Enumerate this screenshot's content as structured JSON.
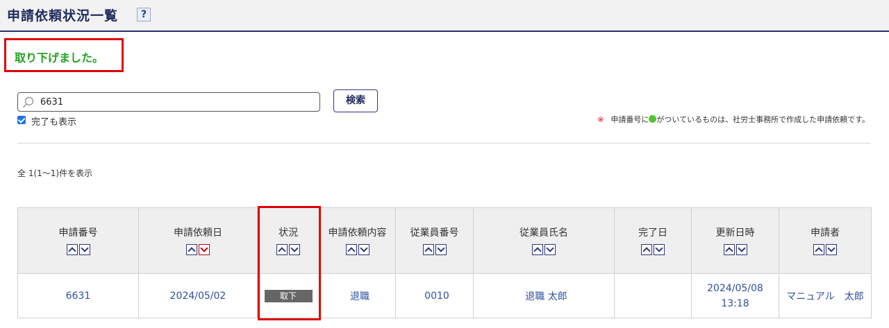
{
  "header": {
    "title": "申請依頼状況一覧",
    "help_label": "?"
  },
  "message": "取り下げました。",
  "search": {
    "value": "6631",
    "button_label": "検索"
  },
  "include_completed": {
    "label": "完了も表示",
    "checked": true
  },
  "note": {
    "mark": "※",
    "text_before": "申請番号に",
    "text_after": "がついているものは、社労士事務所で作成した申請依頼です。"
  },
  "result_count": "全 1(1〜1)件を表示",
  "table": {
    "columns": [
      {
        "label": "申請番号"
      },
      {
        "label": "申請依頼日",
        "active_sort": "down"
      },
      {
        "label": "状況"
      },
      {
        "label": "申請依頼内容"
      },
      {
        "label": "従業員番号"
      },
      {
        "label": "従業員氏名"
      },
      {
        "label": "完了日"
      },
      {
        "label": "更新日時"
      },
      {
        "label": "申請者"
      }
    ],
    "rows": [
      {
        "request_no": "6631",
        "request_date": "2024/05/02",
        "status": "取下",
        "content": "退職",
        "employee_no": "0010",
        "employee_name": "退職 太郎",
        "completed_date": "",
        "updated_date": "2024/05/08",
        "updated_time": "13:18",
        "applicant": "マニュアル　太郎"
      }
    ]
  },
  "colors": {
    "accent": "#1f2a5c",
    "success": "#1fa21f",
    "alert": "#e00000",
    "link": "#2e4fa3"
  }
}
